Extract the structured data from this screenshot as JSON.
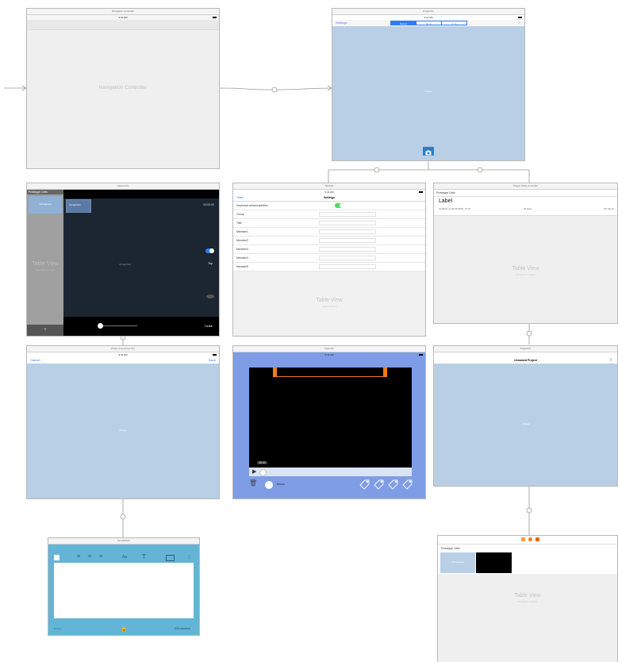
{
  "nav_controller": {
    "title": "Navigation Controller",
    "time": "9:41 AM",
    "center_label": "Navigation Controller"
  },
  "project_list": {
    "title": "ProjectVC",
    "time": "9:41 AM",
    "settings_label": "Settings",
    "segments": [
      "Recent",
      "4 : 3",
      "1 : 1"
    ],
    "add_label": "+",
    "view_label": "UIView"
  },
  "capture": {
    "title": "CaptureVC",
    "prototype_cells": "Prototype Cells",
    "cell_label": "cellImageView",
    "image_view_label": "UIImageView",
    "main_image_label": "UIImageView",
    "timer": "00:00:00",
    "top_label": "Top",
    "close_label": "Close",
    "table_view": "Table View",
    "prototype_content": "Prototype Content",
    "plus": "+"
  },
  "settings": {
    "title": "Settings",
    "time": "9:41 AM",
    "back_label": "Back",
    "nav_title": "Settings",
    "rows": [
      "Keyboard autocompletion",
      "Group",
      "Title",
      "Member1",
      "Member2",
      "Member3",
      "Member4",
      "Member5"
    ],
    "table_view": "Table View",
    "static_content": "Static Content"
  },
  "project_table": {
    "title": "Project Table Controller",
    "prototype_cells": "Prototype Cells",
    "label": "Label",
    "updated": "Updated on 01/11/2016, 14:27",
    "lines": "44 lines",
    "videos": "55 videos",
    "table_view": "Table View",
    "prototype_content": "Prototype Content"
  },
  "photo_crop": {
    "title": "Photo Crop (Crop VC)",
    "time": "9:41 AM",
    "cancel_label": "Cancel",
    "save_label": "Save",
    "view_label": "UIView"
  },
  "video": {
    "title": "VideoVC",
    "time": "9:41 AM",
    "timecode": "00:00",
    "toggle_label": "Bonus"
  },
  "project_detail": {
    "title": "ProjectVC",
    "nav_title": "Unnamed Project",
    "view_label": "UIView"
  },
  "text_editor": {
    "title": "Text EditVC",
    "font_label": "Aa",
    "text_label": "T",
    "left_label": "Bonus",
    "right_label": "3.5s duration"
  },
  "bottom_table": {
    "prototype_cells": "Prototype Cells",
    "cell_label": "cellImageView",
    "table_view": "Table View",
    "prototype_content": "Prototype Content"
  },
  "colors": {
    "ios_blue": "#2f7cf6",
    "canvas_blue": "#b9cfe6",
    "video_blue": "#7f9de6",
    "editor_blue": "#64b4d6",
    "toggle_green": "#4cd964",
    "orange": "#f07c1a"
  }
}
